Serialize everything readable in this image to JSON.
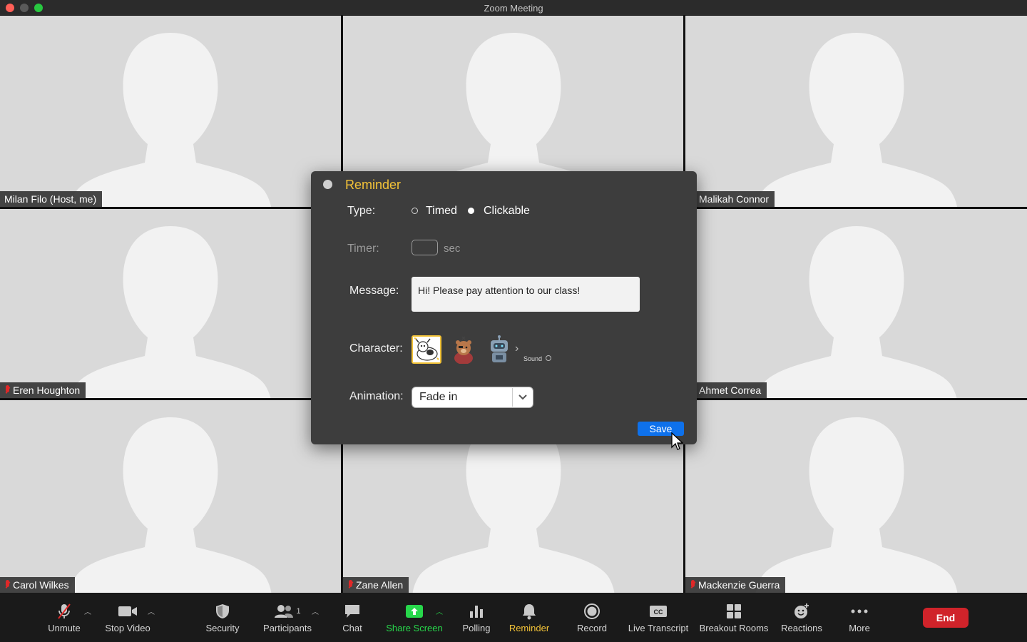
{
  "window": {
    "title": "Zoom Meeting"
  },
  "participants": [
    {
      "name": "Milan Filo (Host, me)",
      "muted": false
    },
    {
      "name": "",
      "muted": false
    },
    {
      "name": "Malikah Connor",
      "muted": false
    },
    {
      "name": "Eren Houghton",
      "muted": true
    },
    {
      "name": "",
      "muted": false
    },
    {
      "name": "Ahmet Correa",
      "muted": false
    },
    {
      "name": "Carol Wilkes",
      "muted": true
    },
    {
      "name": "Zane Allen",
      "muted": true
    },
    {
      "name": "Mackenzie Guerra",
      "muted": true
    }
  ],
  "dialog": {
    "title": "Reminder",
    "type_label": "Type:",
    "type_options": [
      "Timed",
      "Clickable"
    ],
    "type_selected": "Clickable",
    "timer_label": "Timer:",
    "timer_value": "",
    "timer_unit": "sec",
    "message_label": "Message:",
    "message_value": "Hi! Please pay attention to our class!",
    "character_label": "Character:",
    "character_names": [
      "cow-character",
      "pirate-bear-character",
      "robot-character"
    ],
    "sound_label": "Sound",
    "animation_label": "Animation:",
    "animation_value": "Fade in",
    "save_label": "Save"
  },
  "toolbar": {
    "unmute": "Unmute",
    "stop_video": "Stop Video",
    "security": "Security",
    "participants": "Participants",
    "participants_count": "1",
    "chat": "Chat",
    "share_screen": "Share Screen",
    "polling": "Polling",
    "reminder": "Reminder",
    "record": "Record",
    "live_transcript": "Live Transcript",
    "breakout_rooms": "Breakout Rooms",
    "reactions": "Reactions",
    "more": "More",
    "end": "End"
  },
  "colors": {
    "accent_yellow": "#f3c338",
    "share_green": "#27d74b",
    "end_red": "#d0232a",
    "save_blue": "#0e71eb"
  }
}
